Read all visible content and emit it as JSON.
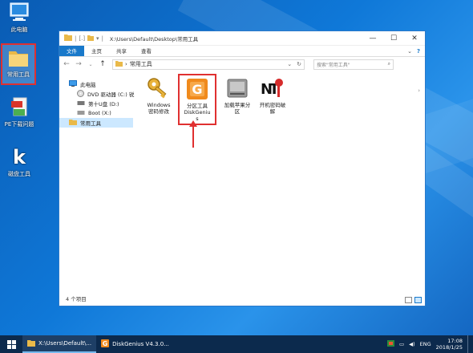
{
  "desktop": {
    "icons": [
      {
        "label": "此电脑",
        "icon": "computer-icon"
      },
      {
        "label": "常用工具",
        "icon": "folder-icon"
      },
      {
        "label": "PE下载问题",
        "icon": "pdf-icon"
      },
      {
        "label": "磁盘工具",
        "icon": "k-app-icon"
      }
    ]
  },
  "window": {
    "title": "X:\\Users\\Default\\Desktop\\常用工具",
    "controls": {
      "minimize": "—",
      "maximize": "☐",
      "close": "✕"
    },
    "ribbon_tabs": [
      "文件",
      "主页",
      "共享",
      "查看"
    ],
    "address": {
      "segments": [
        "常用工具"
      ],
      "separator": "›"
    },
    "search": {
      "placeholder": "搜索\"常用工具\""
    },
    "navpane": {
      "items": [
        {
          "label": "此电脑",
          "icon": "computer-icon"
        },
        {
          "label": "DVD 驱动器 (C:) 锐",
          "icon": "dvd-icon"
        },
        {
          "label": "第十U盘 (D:)",
          "icon": "drive-icon"
        },
        {
          "label": "Boot (X:)",
          "icon": "drive-icon"
        },
        {
          "label": "常用工具",
          "icon": "folder-icon"
        }
      ]
    },
    "files": [
      {
        "line1": "Windows",
        "line2": "密码修改",
        "line3": "",
        "icon": "key-icon"
      },
      {
        "line1": "分区工具",
        "line2": "DiskGeniu",
        "line3": "s",
        "icon": "diskgenius-icon"
      },
      {
        "line1": "加载苹果分",
        "line2": "区",
        "line3": "",
        "icon": "hard-drive-icon"
      },
      {
        "line1": "开机密码破",
        "line2": "解",
        "line3": "",
        "icon": "nt-password-icon"
      }
    ],
    "status": "4 个项目"
  },
  "taskbar": {
    "tasks": [
      {
        "label": "X:\\Users\\Default\\...",
        "icon": "folder-icon"
      },
      {
        "label": "DiskGenius V4.3.0...",
        "icon": "diskgenius-icon"
      }
    ],
    "tray": {
      "lang": "ENG",
      "time": "17:08",
      "date": "2018/1/25"
    }
  },
  "colors": {
    "accent": "#1979ca",
    "highlight": "#e03030",
    "taskbar": "#0c2a4d"
  }
}
